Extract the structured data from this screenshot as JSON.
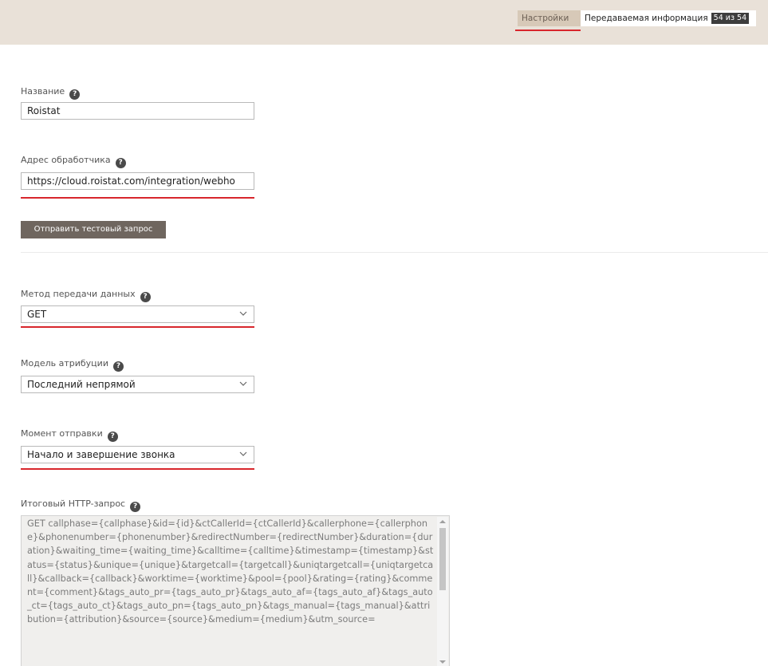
{
  "tabs": {
    "settings_label": "Настройки",
    "info_label": "Передаваемая информация",
    "info_count": "54 из 54"
  },
  "fields": {
    "name": {
      "label": "Название",
      "value": "Roistat"
    },
    "handler_url": {
      "label": "Адрес обработчика",
      "value": "https://cloud.roistat.com/integration/webho"
    },
    "test_button": "Отправить тестовый запрос",
    "method": {
      "label": "Метод передачи данных",
      "value": "GET"
    },
    "attribution": {
      "label": "Модель атрибуции",
      "value": "Последний непрямой"
    },
    "send_moment": {
      "label": "Момент отправки",
      "value": "Начало и завершение звонка"
    },
    "http_request": {
      "label": "Итоговый HTTP-запрос",
      "value": "GET callphase={callphase}&id={id}&ctCallerId={ctCallerId}&callerphone={callerphone}&phonenumber={phonenumber}&redirectNumber={redirectNumber}&duration={duration}&waiting_time={waiting_time}&calltime={calltime}&timestamp={timestamp}&status={status}&unique={unique}&targetcall={targetcall}&uniqtargetcall={uniqtargetcall}&callback={callback}&worktime={worktime}&pool={pool}&rating={rating}&comment={comment}&tags_auto_pr={tags_auto_pr}&tags_auto_af={tags_auto_af}&tags_auto_ct={tags_auto_ct}&tags_auto_pn={tags_auto_pn}&tags_manual={tags_manual}&attribution={attribution}&source={source}&medium={medium}&utm_source="
    }
  },
  "colors": {
    "topbar": "#e9e1d8",
    "active_tab": "#d7c9b8",
    "accent_underline": "#d8262c",
    "button": "#6f665f"
  },
  "icons": {
    "help": "question-circle-icon",
    "dropdown": "chevron-down-icon"
  }
}
